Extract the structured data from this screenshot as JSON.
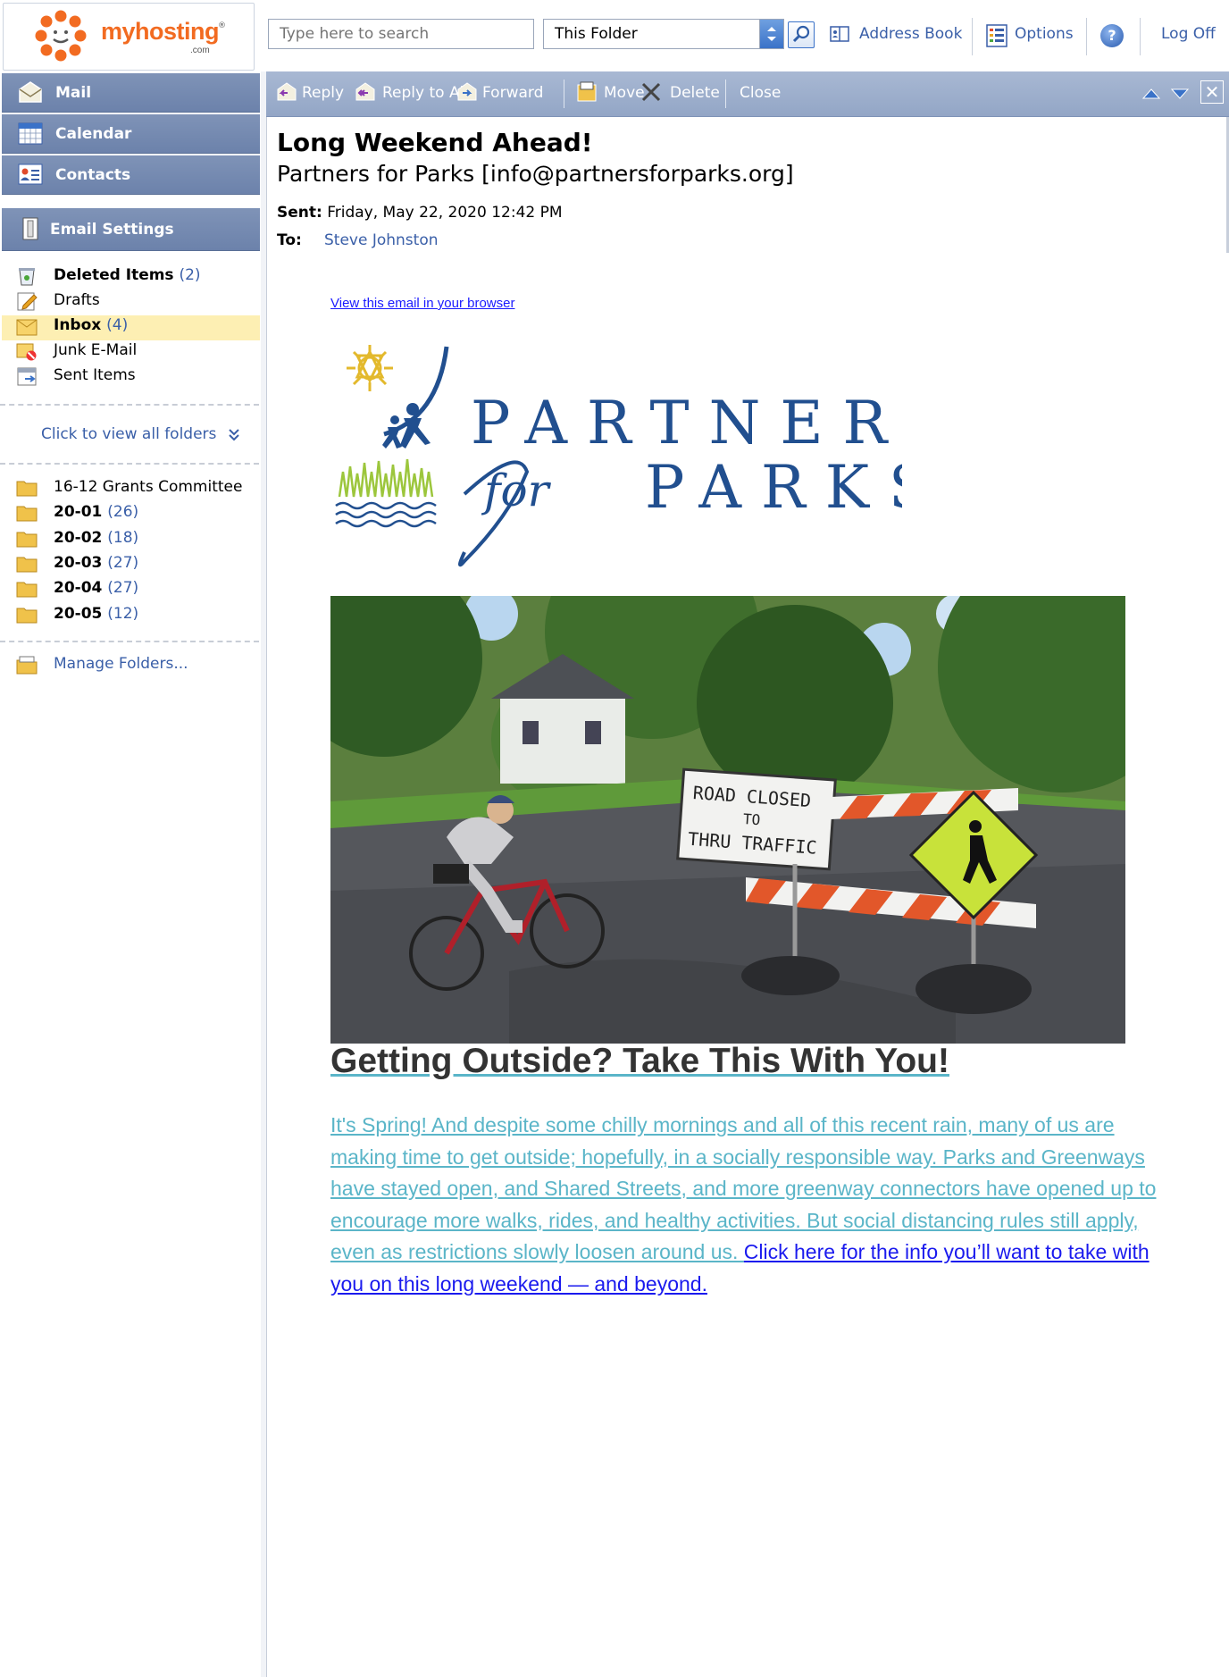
{
  "brand": {
    "logo_main": "myhosting",
    "logo_suffix": ".com",
    "logo_mark": "®"
  },
  "search": {
    "placeholder": "Type here to search",
    "scope": "This Folder"
  },
  "top_links": {
    "address_book": "Address Book",
    "options": "Options",
    "help": "?",
    "log_off": "Log Off"
  },
  "nav": {
    "mail": "Mail",
    "calendar": "Calendar",
    "contacts": "Contacts",
    "email_settings": "Email Settings"
  },
  "folders": [
    {
      "label": "Deleted Items",
      "count": "(2)",
      "bold": true
    },
    {
      "label": "Drafts",
      "count": "",
      "bold": false
    },
    {
      "label": "Inbox",
      "count": "(4)",
      "bold": true
    },
    {
      "label": "Junk E-Mail",
      "count": "",
      "bold": false
    },
    {
      "label": "Sent Items",
      "count": "",
      "bold": false
    }
  ],
  "view_all_folders": "Click to view all folders",
  "custom_folders": [
    {
      "label": "16-12 Grants Committee",
      "count": "",
      "bold": false
    },
    {
      "label": "20-01",
      "count": "(26)",
      "bold": true
    },
    {
      "label": "20-02",
      "count": "(18)",
      "bold": true
    },
    {
      "label": "20-03",
      "count": "(27)",
      "bold": true
    },
    {
      "label": "20-04",
      "count": "(27)",
      "bold": true
    },
    {
      "label": "20-05",
      "count": "(12)",
      "bold": true
    }
  ],
  "manage_folders": "Manage Folders...",
  "toolbar": {
    "reply": "Reply",
    "reply_all": "Reply to All",
    "forward": "Forward",
    "move": "Move",
    "delete": "Delete",
    "close": "Close"
  },
  "message": {
    "subject": "Long Weekend Ahead!",
    "from": "Partners for Parks [info@partnersforparks.org]",
    "sent_label": "Sent:",
    "sent_value": "Friday, May 22, 2020 12:42 PM",
    "to_label": "To:",
    "to_value": "Steve Johnston"
  },
  "email_body": {
    "view_in_browser": "View this email in your browser",
    "logo_line1": "PARTNERS",
    "logo_for": "for",
    "logo_line2": "PARKS",
    "sign_road_closed": "ROAD CLOSED",
    "sign_to": "TO",
    "sign_thru_traffic": "THRU TRAFFIC",
    "headline": "Getting Outside? Take This With You!",
    "paragraph_plain": "It's Spring! And despite some chilly mornings and all of this recent rain, many of us are making time to get outside; hopefully, in a socially responsible way. Parks and Greenways have stayed open, and Shared Streets, and more greenway connectors have opened up to encourage more walks, rides, and healthy activities. But social distancing rules still apply, even as restrictions slowly loosen around us. ",
    "paragraph_link": "Click here for the info you’ll want to take with you on this long weekend — and beyond."
  }
}
